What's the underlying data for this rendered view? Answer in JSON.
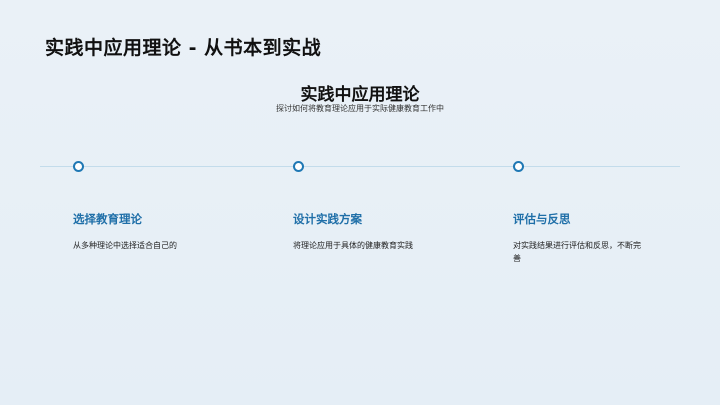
{
  "slide": {
    "title": "实践中应用理论 - 从书本到实战",
    "heading": "实践中应用理论",
    "subheading": "探讨如何将教育理论应用于实际健康教育工作中"
  },
  "colors": {
    "background": "#e6eff6",
    "accent": "#1f78b4",
    "step_title": "#1f6fa8",
    "timeline": "#c3dceb"
  },
  "steps": [
    {
      "title": "选择教育理论",
      "description": "从多种理论中选择适合自己的"
    },
    {
      "title": "设计实践方案",
      "description": "将理论应用于具体的健康教育实践"
    },
    {
      "title": "评估与反思",
      "description": "对实践结果进行评估和反思，不断完善"
    }
  ]
}
